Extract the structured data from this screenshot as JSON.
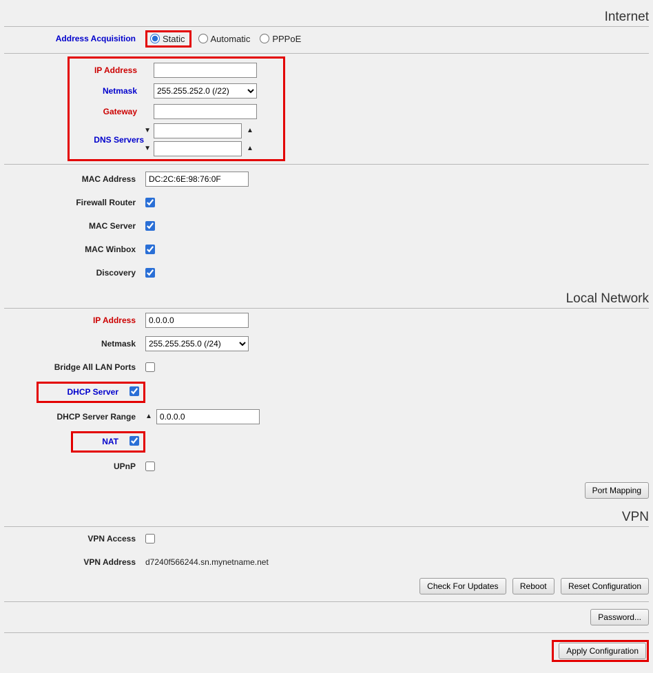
{
  "sections": {
    "internet": "Internet",
    "local_network": "Local Network",
    "vpn": "VPN"
  },
  "internet": {
    "address_acquisition_label": "Address Acquisition",
    "acq_static": "Static",
    "acq_automatic": "Automatic",
    "acq_pppoe": "PPPoE",
    "ip_address_label": "IP Address",
    "ip_address_value": "",
    "netmask_label": "Netmask",
    "netmask_value": "255.255.252.0 (/22)",
    "gateway_label": "Gateway",
    "gateway_value": "",
    "dns_servers_label": "DNS Servers",
    "dns1_value": "",
    "dns2_value": "",
    "mac_address_label": "MAC Address",
    "mac_address_value": "DC:2C:6E:98:76:0F",
    "firewall_router_label": "Firewall Router",
    "mac_server_label": "MAC Server",
    "mac_winbox_label": "MAC Winbox",
    "discovery_label": "Discovery"
  },
  "local": {
    "ip_address_label": "IP Address",
    "ip_address_value": "0.0.0.0",
    "netmask_label": "Netmask",
    "netmask_value": "255.255.255.0 (/24)",
    "bridge_label": "Bridge All LAN Ports",
    "dhcp_server_label": "DHCP Server",
    "dhcp_range_label": "DHCP Server Range",
    "dhcp_range_value": "0.0.0.0",
    "nat_label": "NAT",
    "upnp_label": "UPnP",
    "port_mapping_btn": "Port Mapping"
  },
  "vpn": {
    "access_label": "VPN Access",
    "address_label": "VPN Address",
    "address_value": "d7240f566244.sn.mynetname.net"
  },
  "buttons": {
    "check_updates": "Check For Updates",
    "reboot": "Reboot",
    "reset": "Reset Configuration",
    "password": "Password...",
    "apply": "Apply Configuration"
  }
}
